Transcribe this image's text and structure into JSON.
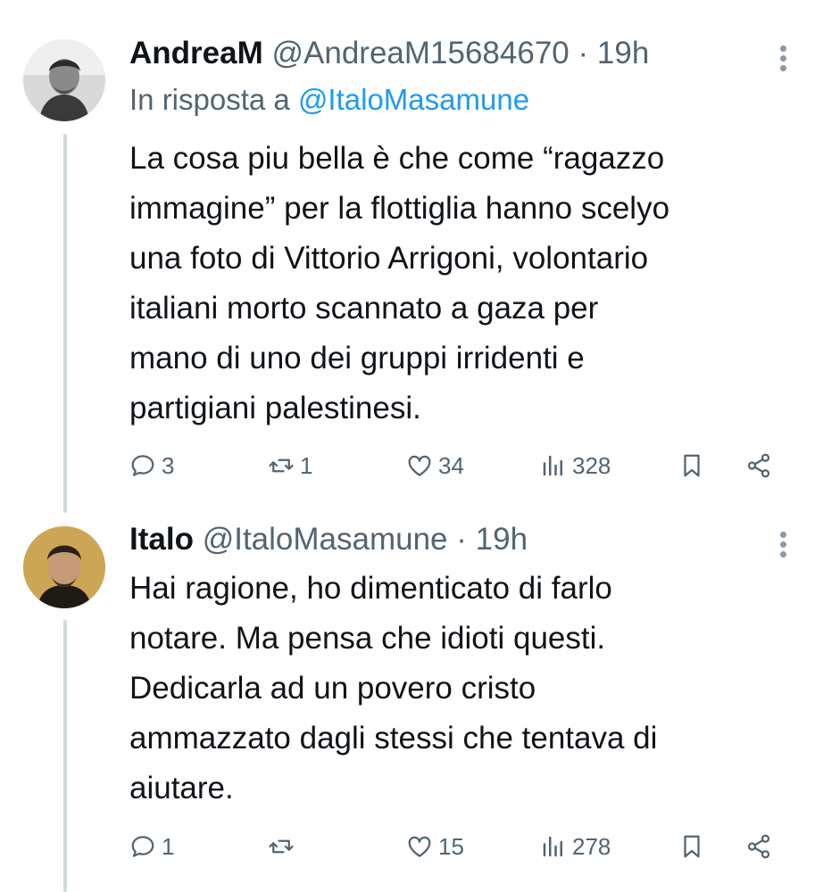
{
  "tweets": [
    {
      "name": "AndreaM",
      "handle": "@AndreaM15684670",
      "separator": "·",
      "time": "19h",
      "replying_prefix": "In risposta a",
      "replying_to": "@ItaloMasamune",
      "lines": [
        "La cosa piu bella è che come “ragazzo",
        "immagine” per la flottiglia hanno scelyo",
        "una foto di Vittorio Arrigoni, volontario",
        "italiani morto scannato a gaza per",
        "mano di uno dei gruppi irridenti e",
        "partigiani palestinesi."
      ],
      "stats": {
        "replies": "3",
        "reposts": "1",
        "likes": "34",
        "views": "328"
      }
    },
    {
      "name": "Italo",
      "handle": "@ItaloMasamune",
      "separator": "·",
      "time": "19h",
      "lines": [
        "Hai ragione, ho dimenticato di farlo",
        "notare. Ma pensa che idioti questi.",
        "Dedicarla ad un povero cristo",
        "ammazzato dagli stessi che tentava di",
        "aiutare."
      ],
      "stats": {
        "replies": "1",
        "reposts": "",
        "likes": "15",
        "views": "278"
      }
    }
  ],
  "icons": {
    "reply": "reply-icon",
    "repost": "repost-icon",
    "like": "heart-icon",
    "views": "views-icon",
    "bookmark": "bookmark-icon",
    "share": "share-icon",
    "more": "more-options-icon"
  },
  "colors": {
    "text": "#0f1419",
    "secondary": "#536471",
    "link": "#1d9bf0",
    "thread_line": "#cfd9de"
  }
}
